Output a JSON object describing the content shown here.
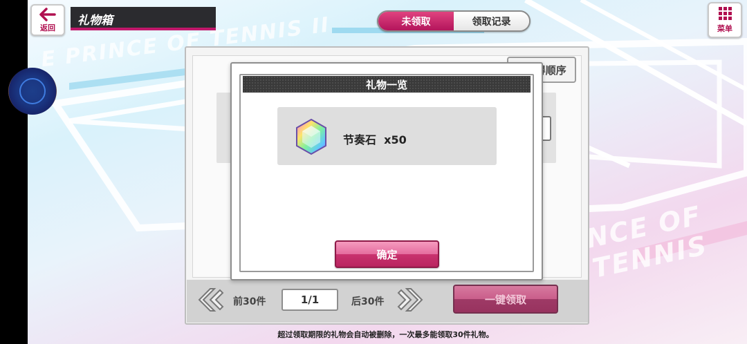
{
  "header": {
    "back_label": "返回",
    "title": "礼物箱",
    "menu_label": "菜单"
  },
  "tabs": [
    {
      "label": "未领取",
      "active": true
    },
    {
      "label": "领取记录",
      "active": false
    }
  ],
  "background": {
    "watermark_text_1": "E PRINCE OF TENNIS II",
    "watermark_text_2": "NCE OF TENNIS"
  },
  "gift_box": {
    "sort_label": "▼获得顺序",
    "pager": {
      "prev_label": "前30件",
      "page": "1/1",
      "next_label": "后30件"
    },
    "claim_all_label": "一键领取"
  },
  "dialog": {
    "title": "礼物一览",
    "items": [
      {
        "name": "节奏石",
        "quantity": "x50",
        "icon": "rainbow-gem-icon"
      }
    ],
    "confirm_label": "确定"
  },
  "footer_note": "超过领取期限的礼物会自动被删除，一次最多能领取30件礼物。",
  "colors": {
    "accent": "#c0176a",
    "header_dark": "#2b2b2f"
  }
}
